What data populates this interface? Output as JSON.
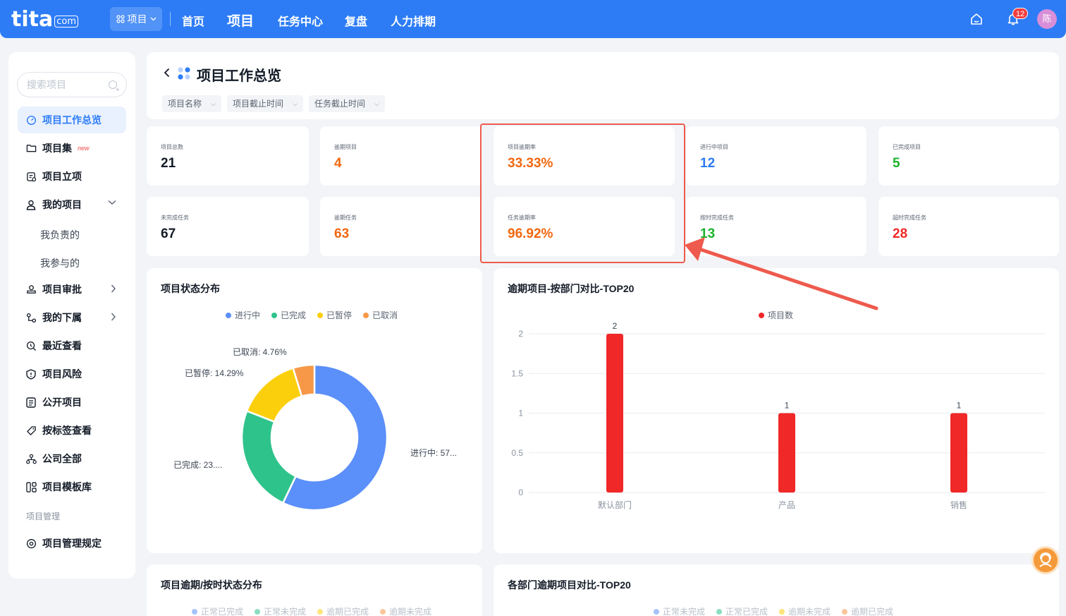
{
  "topbar": {
    "logo": "tita",
    "logo_suffix": "com",
    "project_switch": "项目",
    "nav": [
      "首页",
      "项目",
      "任务中心",
      "复盘",
      "人力排期"
    ],
    "active_nav": "项目",
    "notification_count": "12",
    "avatar_text": "陈"
  },
  "sidebar": {
    "search_placeholder": "搜索项目",
    "items": [
      {
        "label": "项目工作总览",
        "icon": "dashboard-icon",
        "active": true
      },
      {
        "label": "项目集",
        "icon": "folder-icon",
        "tag": "new"
      },
      {
        "label": "项目立项",
        "icon": "clipboard-icon"
      },
      {
        "label": "我的项目",
        "icon": "user-icon"
      },
      {
        "label": "我负责的"
      },
      {
        "label": "我参与的"
      },
      {
        "label": "项目审批",
        "icon": "approval-icon"
      },
      {
        "label": "我的下属",
        "icon": "org-icon"
      },
      {
        "label": "最近查看",
        "icon": "recent-icon"
      },
      {
        "label": "项目风险",
        "icon": "shield-icon"
      },
      {
        "label": "公开项目",
        "icon": "list-icon"
      },
      {
        "label": "按标签查看",
        "icon": "tag-icon"
      },
      {
        "label": "公司全部",
        "icon": "company-icon"
      },
      {
        "label": "项目模板库",
        "icon": "template-icon"
      },
      {
        "label": "项目管理"
      },
      {
        "label": "项目管理规定",
        "icon": "rules-icon"
      }
    ]
  },
  "header": {
    "title": "项目工作总览",
    "filters": [
      "项目名称",
      "项目截止时间",
      "任务截止时间"
    ]
  },
  "stats": [
    {
      "label": "项目总数",
      "value": "21"
    },
    {
      "label": "逾期项目",
      "value": "4"
    },
    {
      "label": "项目逾期率",
      "value": "33.33%"
    },
    {
      "label": "进行中项目",
      "value": "12"
    },
    {
      "label": "已完成项目",
      "value": "5"
    },
    {
      "label": "未完成任务",
      "value": "67"
    },
    {
      "label": "逾期任务",
      "value": "63"
    },
    {
      "label": "任务逾期率",
      "value": "96.92%"
    },
    {
      "label": "按时完成任务",
      "value": "13"
    },
    {
      "label": "超时完成任务",
      "value": "28"
    }
  ],
  "colors": {
    "primary": "#2d7cf6",
    "orange": "#f2680f",
    "green": "#1ab42b",
    "red": "#f02828",
    "highlight": "#ee5a4d"
  },
  "chart_data": [
    {
      "type": "pie",
      "title": "项目状态分布",
      "legend": [
        "进行中",
        "已完成",
        "已暂停",
        "已取消"
      ],
      "colors": [
        "#5b8ff9",
        "#2fc38c",
        "#fccf0d",
        "#f79848"
      ],
      "values": [
        57.14,
        23.81,
        14.29,
        4.76
      ],
      "slice_labels": [
        "进行中: 57...",
        "已完成: 23....",
        "已暂停: 14.29%",
        "已取消: 4.76%"
      ]
    },
    {
      "type": "bar",
      "title": "逾期项目-按部门对比-TOP20",
      "series": [
        {
          "name": "项目数",
          "values": [
            2,
            1,
            1
          ]
        }
      ],
      "categories": [
        "默认部门",
        "产品",
        "销售"
      ],
      "ylim": [
        0,
        2
      ],
      "yticks": [
        "2",
        "1.5",
        "1",
        "0.5",
        "0"
      ],
      "color": "#f02828"
    }
  ],
  "lower_cards": [
    {
      "title": "项目逾期/按时状态分布",
      "legend": [
        "正常已完成",
        "正常未完成",
        "逾期已完成",
        "逾期未完成"
      ],
      "colors": [
        "#5b8ff9",
        "#2fc38c",
        "#fccf0d",
        "#f79848"
      ]
    },
    {
      "title": "各部门逾期项目对比-TOP20",
      "legend": [
        "正常未完成",
        "正常已完成",
        "逾期未完成",
        "逾期已完成"
      ],
      "colors": [
        "#5b8ff9",
        "#2fc38c",
        "#fccf0d",
        "#f79848"
      ]
    }
  ]
}
